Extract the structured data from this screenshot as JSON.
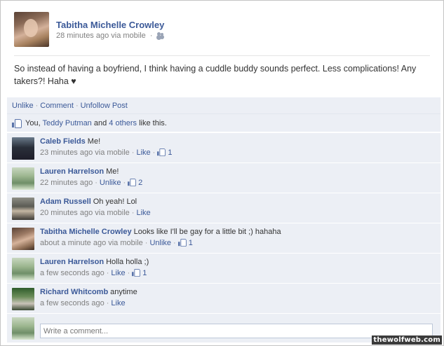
{
  "post": {
    "author": "Tabitha Michelle Crowley",
    "time": "28 minutes ago via mobile",
    "separator": "·",
    "audience_icon": "friends-audience-icon",
    "body": "So instead of having a boyfriend, I think having a cuddle buddy sounds perfect. Less complications! Any takers?! Haha ♥"
  },
  "actions": {
    "unlike": "Unlike",
    "comment": "Comment",
    "unfollow": "Unfollow Post",
    "separator": "·"
  },
  "likes": {
    "prefix": "You,",
    "person": "Teddy Putman",
    "and": "and",
    "others": "4 others",
    "suffix": "like this."
  },
  "comments": [
    {
      "name": "Caleb Fields",
      "text": "Me!",
      "time": "23 minutes ago via mobile",
      "action": "Like",
      "likes": "1"
    },
    {
      "name": "Lauren Harrelson",
      "text": "Me!",
      "time": "22 minutes ago",
      "action": "Unlike",
      "likes": "2"
    },
    {
      "name": "Adam Russell",
      "text": "Oh yeah! Lol",
      "time": "20 minutes ago via mobile",
      "action": "Like",
      "likes": ""
    },
    {
      "name": "Tabitha Michelle Crowley",
      "text": "Looks like I'll be gay for a little bit ;) hahaha",
      "time": "about a minute ago via mobile",
      "action": "Unlike",
      "likes": "1"
    },
    {
      "name": "Lauren Harrelson",
      "text": "Holla holla ;)",
      "time": "a few seconds ago",
      "action": "Like",
      "likes": "1"
    },
    {
      "name": "Richard Whitcomb",
      "text": "anytime",
      "time": "a few seconds ago",
      "action": "Like",
      "likes": ""
    }
  ],
  "compose": {
    "placeholder": "Write a comment..."
  },
  "watermark": "thewolfweb.com",
  "colors": {
    "link": "#3b5998",
    "ufi_background": "#eceff5",
    "meta_gray": "#808080"
  }
}
